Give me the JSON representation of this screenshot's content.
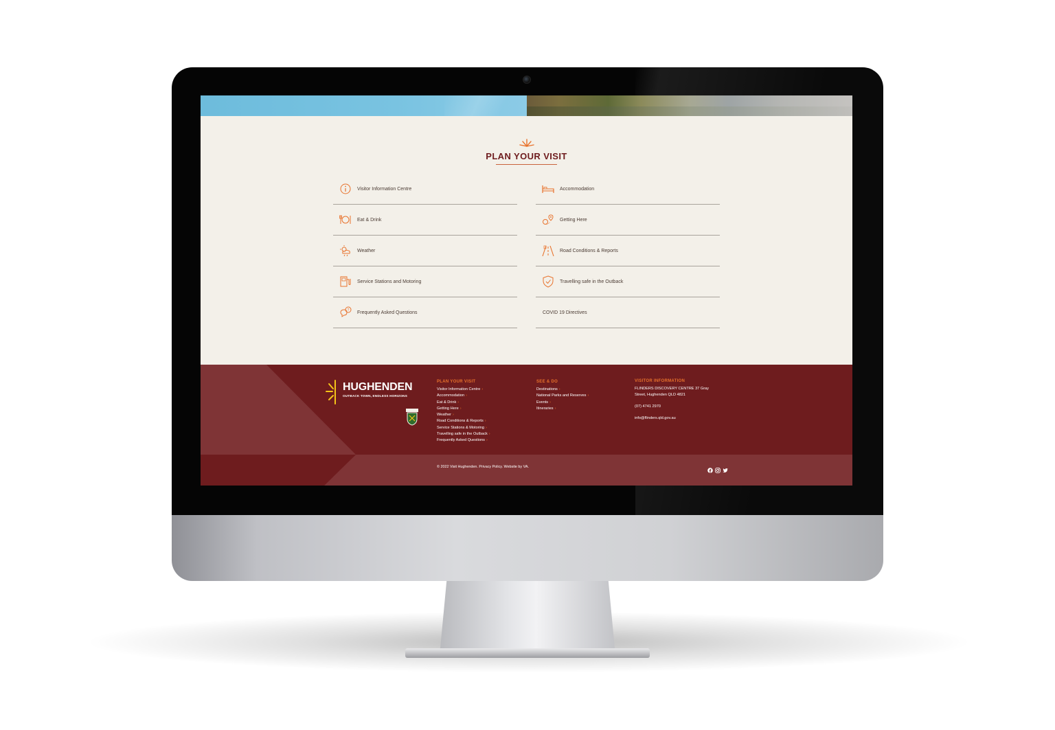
{
  "plan": {
    "title": "PLAN YOUR VISIT",
    "items_left": [
      {
        "label": "Visitor Information Centre",
        "icon": "info-icon"
      },
      {
        "label": "Eat & Drink",
        "icon": "cutlery-icon"
      },
      {
        "label": "Weather",
        "icon": "weather-icon"
      },
      {
        "label": "Service Stations and Motoring",
        "icon": "fuel-pump-icon"
      },
      {
        "label": "Frequently Asked Questions",
        "icon": "faq-icon"
      }
    ],
    "items_right": [
      {
        "label": "Accommodation",
        "icon": "bed-icon"
      },
      {
        "label": "Getting Here",
        "icon": "map-pin-icon"
      },
      {
        "label": "Road Conditions & Reports",
        "icon": "road-icon"
      },
      {
        "label": "Travelling safe in the Outback",
        "icon": "shield-icon"
      },
      {
        "label": "COVID 19 Directives"
      }
    ]
  },
  "footer": {
    "logo_name": "HUGHENDEN",
    "logo_tagline": "OUTBACK TOWN, ENDLESS HORIZONS",
    "plan_heading": "PLAN YOUR VISIT",
    "plan_links": [
      "Visitor Information Centre",
      "Accommodation",
      "Eat & Drink",
      "Getting Here",
      "Weather",
      "Road Conditions & Reports",
      "Service Stations & Motoring",
      "Travelling safe in the Outback",
      "Frequently Asked Questions"
    ],
    "see_heading": "SEE & DO",
    "see_links": [
      "Destinations",
      "National Parks and Reserves",
      "Events",
      "Itineraries"
    ],
    "visitor_heading": "VISITOR INFORMATION",
    "address_line1": "FLINDERS DISCOVERY CENTRE 37 Gray",
    "address_line2": "Street, Hughenden QLD 4821",
    "phone": "(07) 4741 2970",
    "email": "info@flinders.qld.gov.au",
    "copyright": "© 2022 Visit Hughenden. Privacy Policy. Website by VA.",
    "social_icons": [
      "facebook-icon",
      "instagram-icon",
      "twitter-icon"
    ]
  },
  "colors": {
    "maroon": "#6e1c1e",
    "accent_orange": "#e8722c",
    "cream": "#f3f0e9",
    "logo_yellow": "#f5c518"
  }
}
